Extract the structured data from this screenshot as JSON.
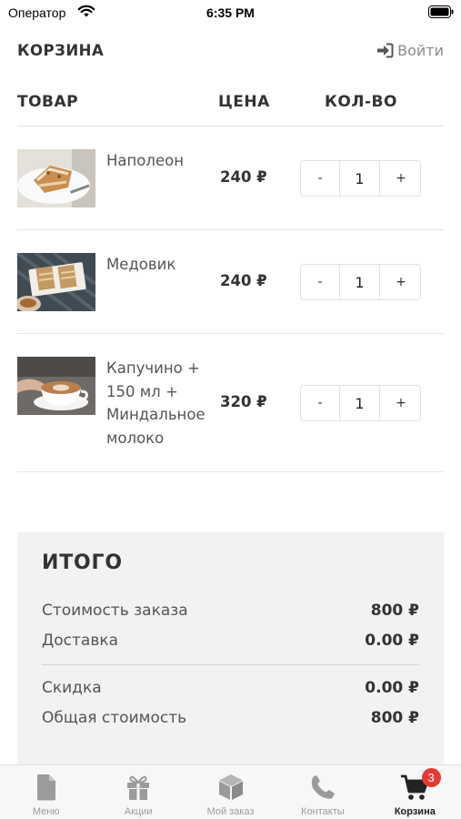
{
  "status_bar": {
    "carrier": "Оператор",
    "time": "6:35 PM"
  },
  "header": {
    "title": "КОРЗИНА",
    "login_label": "Войти"
  },
  "table": {
    "columns": [
      "ТОВАР",
      "ЦЕНА",
      "КОЛ-ВО"
    ]
  },
  "cart_items": [
    {
      "name": "Наполеон",
      "price": "240 ₽",
      "quantity": "1",
      "image_icon": "napoleon-cake-photo"
    },
    {
      "name": "Медовик",
      "price": "240 ₽",
      "quantity": "1",
      "image_icon": "medovik-cake-photo"
    },
    {
      "name": "Капучино + 150 мл + Миндальное молоко",
      "price": "320 ₽",
      "quantity": "1",
      "image_icon": "cappuccino-photo"
    }
  ],
  "stepper": {
    "minus_label": "-",
    "plus_label": "+"
  },
  "summary": {
    "title": "ИТОГО",
    "lines": [
      {
        "label": "Стоимость заказа",
        "value": "800 ₽"
      },
      {
        "label": "Доставка",
        "value": "0.00 ₽"
      },
      {
        "label": "Скидка",
        "value": "0.00 ₽"
      },
      {
        "label": "Общая стоимость",
        "value": "800 ₽"
      }
    ]
  },
  "tab_bar": {
    "tabs": [
      {
        "label": "Меню",
        "icon": "document-icon"
      },
      {
        "label": "Акции",
        "icon": "gift-icon"
      },
      {
        "label": "Мой заказ",
        "icon": "box-icon"
      },
      {
        "label": "Контакты",
        "icon": "phone-icon"
      },
      {
        "label": "Корзина",
        "icon": "cart-icon",
        "active": true,
        "badge": "3"
      }
    ]
  },
  "colors": {
    "text": "#333333",
    "muted": "#8a8a8a",
    "summary_bg": "#f2f2f2",
    "badge": "#e53935",
    "tab_inactive": "#9b9b9b"
  }
}
